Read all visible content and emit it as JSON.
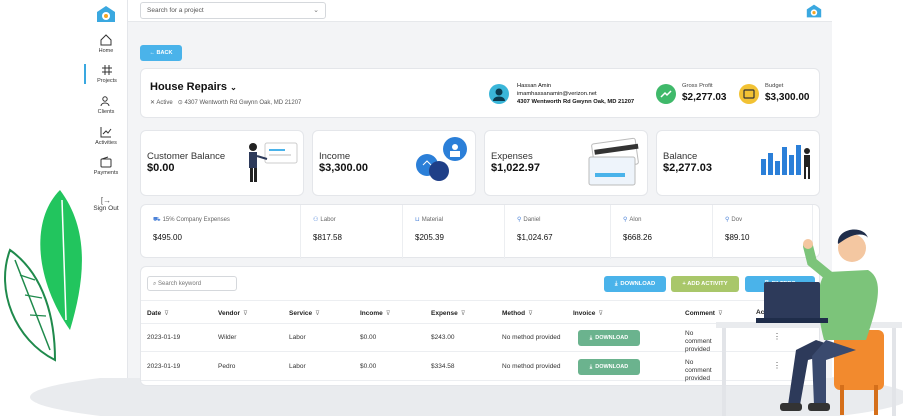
{
  "search": {
    "placeholder": "Search for a project"
  },
  "nav": [
    {
      "label": "Home",
      "icon": "home-icon"
    },
    {
      "label": "Projects",
      "icon": "grid-icon"
    },
    {
      "label": "Clients",
      "icon": "users-icon"
    },
    {
      "label": "Activities",
      "icon": "chart-icon"
    },
    {
      "label": "Payments",
      "icon": "wallet-icon"
    },
    {
      "label": "Sign Out",
      "icon": "sign-out-icon"
    }
  ],
  "back_label": "← BACK",
  "project": {
    "title": "House Repairs",
    "status": "Active",
    "address": "4307 Wentworth Rd Gwynn Oak, MD 21207",
    "owner_name": "Hassan Amin",
    "owner_email": "imamhassanamin@verizon.net",
    "owner_address": "4307 Wentworth Rd Gwynn Oak, MD 21207",
    "gross_profit_label": "Gross Profit",
    "gross_profit": "$2,277.03",
    "budget_label": "Budget",
    "budget": "$3,300.00"
  },
  "kpis": [
    {
      "label": "Customer Balance",
      "value": "$0.00"
    },
    {
      "label": "Income",
      "value": "$3,300.00"
    },
    {
      "label": "Expenses",
      "value": "$1,022.97"
    },
    {
      "label": "Balance",
      "value": "$2,277.03"
    }
  ],
  "expense_breakdown": [
    {
      "label": "15% Company Expenses",
      "value": "$495.00",
      "icon": "car-icon"
    },
    {
      "label": "Labor",
      "value": "$817.58",
      "icon": "users-icon"
    },
    {
      "label": "Material",
      "value": "$205.39",
      "icon": "cart-icon"
    },
    {
      "label": "Daniel",
      "value": "$1,024.67",
      "icon": "user-icon"
    },
    {
      "label": "Alon",
      "value": "$668.26",
      "icon": "user-icon"
    },
    {
      "label": "Dov",
      "value": "$89.10",
      "icon": "user-icon"
    }
  ],
  "table": {
    "search_placeholder": "Search keyword",
    "download_label": "DOWNLOAD",
    "add_activity_label": "+ ADD ACTIVITY",
    "filters_label": "FILTERS",
    "columns": [
      "Date",
      "Vendor",
      "Service",
      "Income",
      "Expense",
      "Method",
      "Invoice",
      "Comment",
      "Actions"
    ],
    "rows": [
      {
        "date": "2023-01-19",
        "vendor": "Wilder",
        "service": "Labor",
        "income": "$0.00",
        "expense": "$243.00",
        "method": "No method provided",
        "invoice": "DOWNLOAD",
        "comment": "No comment provided"
      },
      {
        "date": "2023-01-19",
        "vendor": "Pedro",
        "service": "Labor",
        "income": "$0.00",
        "expense": "$334.58",
        "method": "No method provided",
        "invoice": "DOWNLOAD",
        "comment": "No comment provided"
      }
    ]
  },
  "colors": {
    "accent": "#4ab3ea",
    "green_button": "#6bb38e",
    "activity_button": "#a9c76a"
  }
}
